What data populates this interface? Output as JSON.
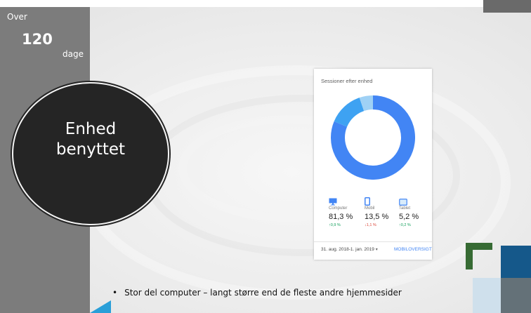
{
  "slide": {
    "over": "Over",
    "number": "120",
    "unit": "dage",
    "circle_title_line1": "Enhed",
    "circle_title_line2": "benyttet",
    "bullet": "Stor del computer – langt større end de fleste andre hjemmesider"
  },
  "card": {
    "title": "Sessioner efter enhed",
    "devices": [
      {
        "label": "Computer",
        "pct": "81,3 %",
        "change": "↑0,9 %",
        "trend": "up",
        "icon": "desktop-icon"
      },
      {
        "label": "Mobil",
        "pct": "13,5 %",
        "change": "↓1,1 %",
        "trend": "down",
        "icon": "mobile-icon"
      },
      {
        "label": "Tablet",
        "pct": "5,2 %",
        "change": "↑0,2 %",
        "trend": "up",
        "icon": "tablet-icon"
      }
    ],
    "date_range": "31. aug. 2018-1. jan. 2019",
    "date_caret": "▾",
    "link": "MOBILOVERSIGT"
  },
  "chart_data": {
    "type": "pie",
    "variant": "donut",
    "title": "Sessioner efter enhed",
    "categories": [
      "Computer",
      "Mobil",
      "Tablet"
    ],
    "values": [
      81.3,
      13.5,
      5.2
    ]
  },
  "colors": {
    "computer": "#4285f4",
    "mobil": "#3ea2f2",
    "tablet": "#9fd1f5",
    "up": "#0f9d58",
    "down": "#db4437",
    "link": "#4285f4"
  }
}
